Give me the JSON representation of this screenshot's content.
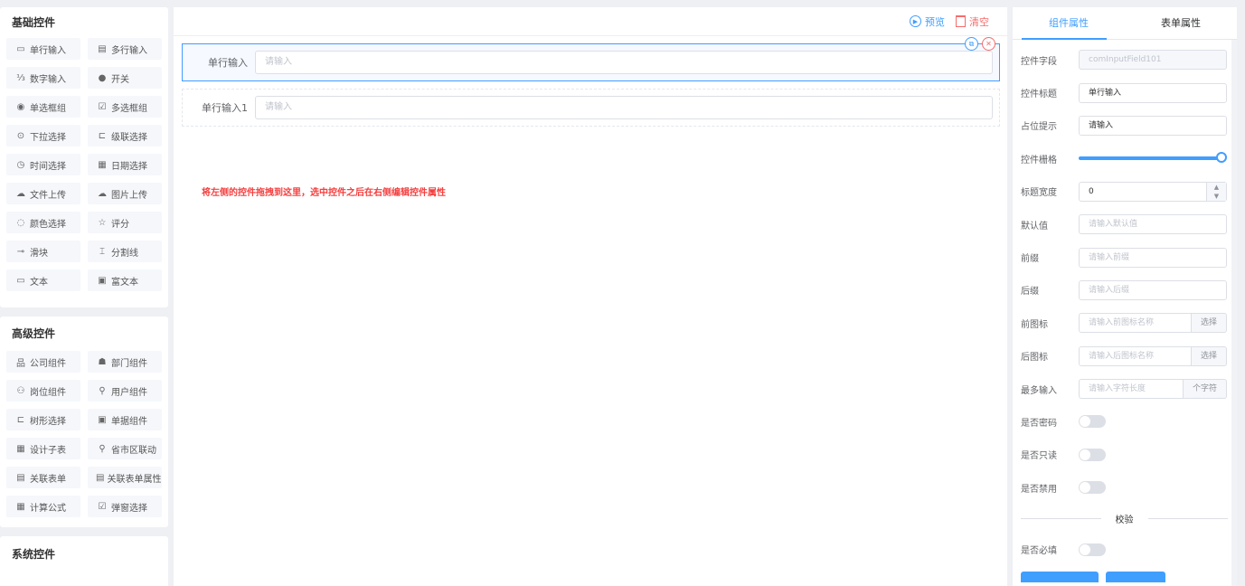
{
  "left": {
    "groups": [
      {
        "title": "基础控件",
        "items": [
          {
            "icon": "▭",
            "label": "单行输入"
          },
          {
            "icon": "▤",
            "label": "多行输入"
          },
          {
            "icon": "⅓",
            "label": "数字输入"
          },
          {
            "icon": "●",
            "label": "开关"
          },
          {
            "icon": "◉",
            "label": "单选框组"
          },
          {
            "icon": "☑",
            "label": "多选框组"
          },
          {
            "icon": "⊙",
            "label": "下拉选择"
          },
          {
            "icon": "⊏",
            "label": "级联选择"
          },
          {
            "icon": "◷",
            "label": "时间选择"
          },
          {
            "icon": "▦",
            "label": "日期选择"
          },
          {
            "icon": "☁",
            "label": "文件上传"
          },
          {
            "icon": "☁",
            "label": "图片上传"
          },
          {
            "icon": "◌",
            "label": "颜色选择"
          },
          {
            "icon": "☆",
            "label": "评分"
          },
          {
            "icon": "⊸",
            "label": "滑块"
          },
          {
            "icon": "⌶",
            "label": "分割线"
          },
          {
            "icon": "▭",
            "label": "文本"
          },
          {
            "icon": "▣",
            "label": "富文本"
          }
        ]
      },
      {
        "title": "高级控件",
        "items": [
          {
            "icon": "品",
            "label": "公司组件"
          },
          {
            "icon": "☗",
            "label": "部门组件"
          },
          {
            "icon": "⚇",
            "label": "岗位组件"
          },
          {
            "icon": "⚲",
            "label": "用户组件"
          },
          {
            "icon": "⊏",
            "label": "树形选择"
          },
          {
            "icon": "▣",
            "label": "单据组件"
          },
          {
            "icon": "▦",
            "label": "设计子表"
          },
          {
            "icon": "⚲",
            "label": "省市区联动"
          },
          {
            "icon": "▤",
            "label": "关联表单"
          },
          {
            "icon": "▤",
            "label": "关联表单属性"
          },
          {
            "icon": "▦",
            "label": "计算公式"
          },
          {
            "icon": "☑",
            "label": "弹窗选择"
          }
        ]
      },
      {
        "title": "系统控件",
        "items": []
      }
    ]
  },
  "toolbar": {
    "preview_label": "预览",
    "clear_label": "清空"
  },
  "canvas": {
    "fields": [
      {
        "label": "单行输入",
        "placeholder": "请输入",
        "active": true
      },
      {
        "label": "单行输入1",
        "placeholder": "请输入",
        "active": false
      }
    ],
    "hint": "将左侧的控件拖拽到这里，选中控件之后在右侧编辑控件属性"
  },
  "right": {
    "tabs": [
      "组件属性",
      "表单属性"
    ],
    "active_tab": 0,
    "props": {
      "field_label": "控件字段",
      "field_value": "comInputField101",
      "title_label": "控件标题",
      "title_value": "单行输入",
      "placeholder_label": "占位提示",
      "placeholder_value": "请输入",
      "grid_label": "控件栅格",
      "grid_value": 1.0,
      "width_label": "标题宽度",
      "width_value": "0",
      "default_label": "默认值",
      "default_placeholder": "请输入默认值",
      "prefix_label": "前缀",
      "prefix_placeholder": "请输入前缀",
      "suffix_label": "后缀",
      "suffix_placeholder": "请输入后缀",
      "prefix_icon_label": "前图标",
      "prefix_icon_placeholder": "请输入前图标名称",
      "suffix_icon_label": "后图标",
      "suffix_icon_placeholder": "请输入后图标名称",
      "select_label": "选择",
      "maxlen_label": "最多输入",
      "maxlen_placeholder": "请输入字符长度",
      "maxlen_unit": "个字符",
      "password_label": "是否密码",
      "readonly_label": "是否只读",
      "disabled_label": "是否禁用",
      "validation_label": "校验",
      "required_label": "是否必填"
    }
  },
  "colors": {
    "primary": "#409eff",
    "danger": "#f56c6c",
    "hint": "#f53f3f"
  }
}
